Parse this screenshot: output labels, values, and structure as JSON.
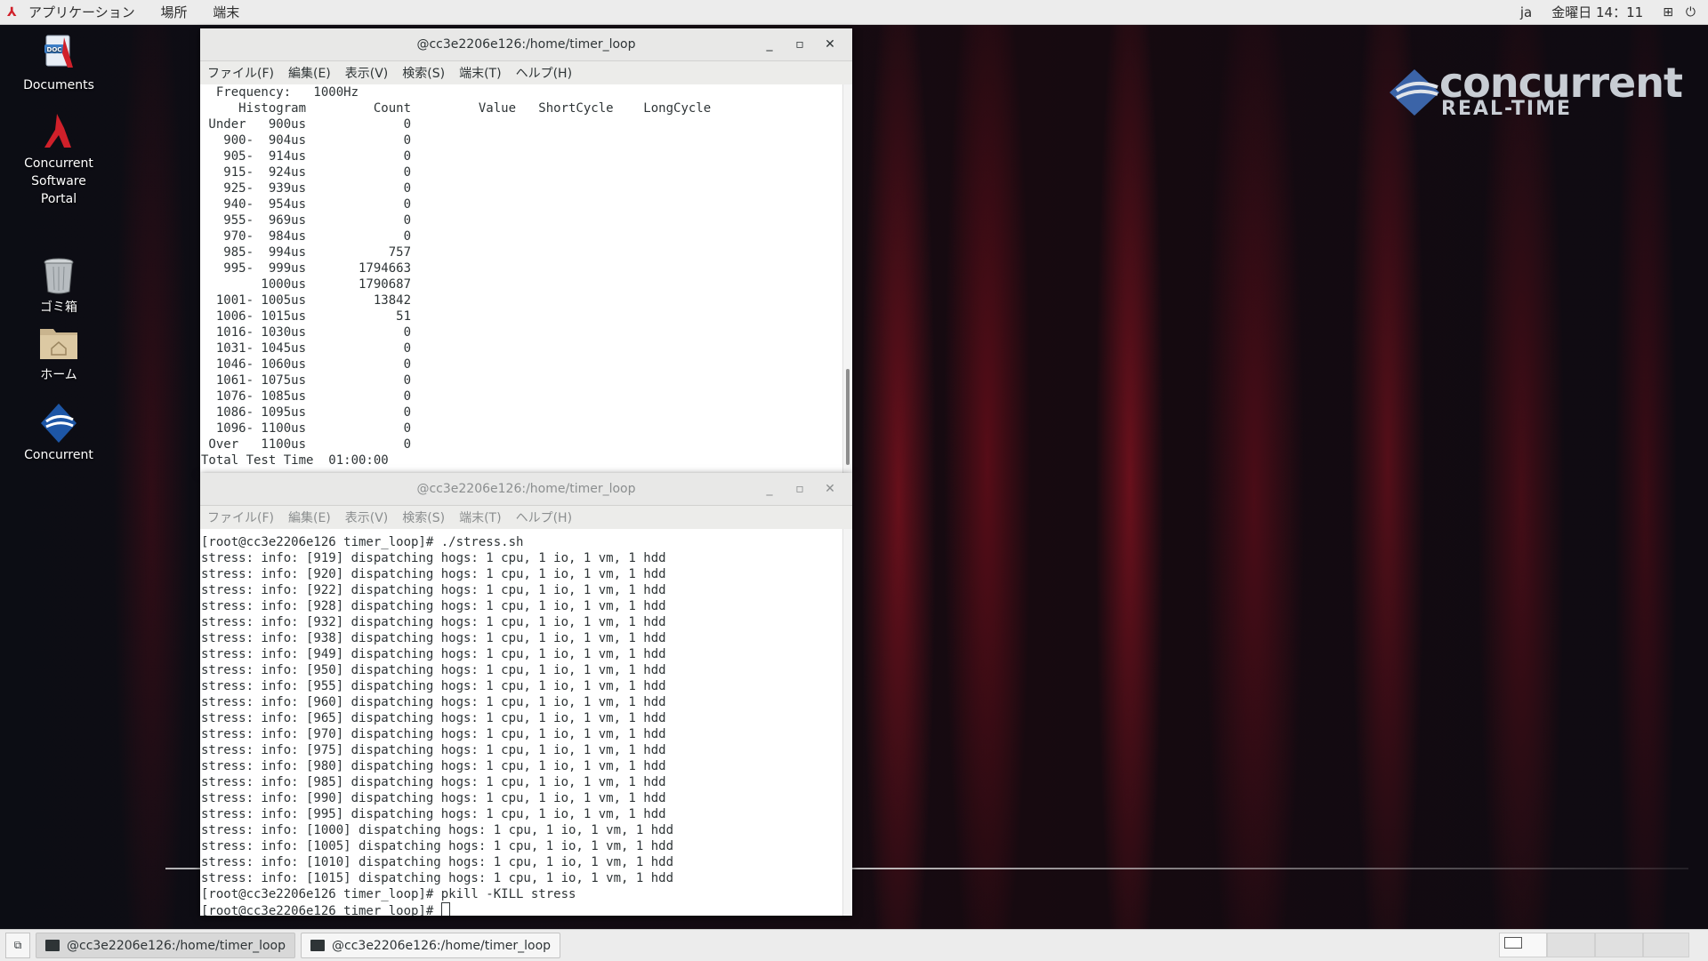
{
  "topbar": {
    "menus": [
      "アプリケーション",
      "場所",
      "端末"
    ],
    "lang": "ja",
    "clock": "金曜日 14：11"
  },
  "desktop": {
    "icons": [
      {
        "label": "Documents"
      },
      {
        "label": "Concurrent\nSoftware\nPortal"
      },
      {
        "label": "ゴミ箱"
      },
      {
        "label": "ホーム"
      },
      {
        "label": "Concurrent"
      }
    ],
    "logo": {
      "line1": "concurrent",
      "line2": "REAL-TIME"
    }
  },
  "window1": {
    "title": "@cc3e2206e126:/home/timer_loop",
    "menu": [
      "ファイル(F)",
      "編集(E)",
      "表示(V)",
      "検索(S)",
      "端末(T)",
      "ヘルプ(H)"
    ],
    "lines": [
      "  Frequency:   1000Hz",
      "     Histogram         Count         Value   ShortCycle    LongCycle",
      " Under   900us             0",
      "   900-  904us             0",
      "   905-  914us             0",
      "   915-  924us             0",
      "   925-  939us             0",
      "   940-  954us             0",
      "   955-  969us             0",
      "   970-  984us             0",
      "   985-  994us           757",
      "   995-  999us       1794663",
      "        1000us       1790687",
      "  1001- 1005us         13842",
      "  1006- 1015us            51",
      "  1016- 1030us             0",
      "  1031- 1045us             0",
      "  1046- 1060us             0",
      "  1061- 1075us             0",
      "  1076- 1085us             0",
      "  1086- 1095us             0",
      "  1096- 1100us             0",
      " Over   1100us             0",
      "Total Test Time  01:00:00"
    ]
  },
  "window2": {
    "title": "@cc3e2206e126:/home/timer_loop",
    "menu": [
      "ファイル(F)",
      "編集(E)",
      "表示(V)",
      "検索(S)",
      "端末(T)",
      "ヘルプ(H)"
    ],
    "lines": [
      "[root@cc3e2206e126 timer_loop]# ./stress.sh",
      "stress: info: [919] dispatching hogs: 1 cpu, 1 io, 1 vm, 1 hdd",
      "stress: info: [920] dispatching hogs: 1 cpu, 1 io, 1 vm, 1 hdd",
      "stress: info: [922] dispatching hogs: 1 cpu, 1 io, 1 vm, 1 hdd",
      "stress: info: [928] dispatching hogs: 1 cpu, 1 io, 1 vm, 1 hdd",
      "stress: info: [932] dispatching hogs: 1 cpu, 1 io, 1 vm, 1 hdd",
      "stress: info: [938] dispatching hogs: 1 cpu, 1 io, 1 vm, 1 hdd",
      "stress: info: [949] dispatching hogs: 1 cpu, 1 io, 1 vm, 1 hdd",
      "stress: info: [950] dispatching hogs: 1 cpu, 1 io, 1 vm, 1 hdd",
      "stress: info: [955] dispatching hogs: 1 cpu, 1 io, 1 vm, 1 hdd",
      "stress: info: [960] dispatching hogs: 1 cpu, 1 io, 1 vm, 1 hdd",
      "stress: info: [965] dispatching hogs: 1 cpu, 1 io, 1 vm, 1 hdd",
      "stress: info: [970] dispatching hogs: 1 cpu, 1 io, 1 vm, 1 hdd",
      "stress: info: [975] dispatching hogs: 1 cpu, 1 io, 1 vm, 1 hdd",
      "stress: info: [980] dispatching hogs: 1 cpu, 1 io, 1 vm, 1 hdd",
      "stress: info: [985] dispatching hogs: 1 cpu, 1 io, 1 vm, 1 hdd",
      "stress: info: [990] dispatching hogs: 1 cpu, 1 io, 1 vm, 1 hdd",
      "stress: info: [995] dispatching hogs: 1 cpu, 1 io, 1 vm, 1 hdd",
      "stress: info: [1000] dispatching hogs: 1 cpu, 1 io, 1 vm, 1 hdd",
      "stress: info: [1005] dispatching hogs: 1 cpu, 1 io, 1 vm, 1 hdd",
      "stress: info: [1010] dispatching hogs: 1 cpu, 1 io, 1 vm, 1 hdd",
      "stress: info: [1015] dispatching hogs: 1 cpu, 1 io, 1 vm, 1 hdd",
      "[root@cc3e2206e126 timer_loop]# pkill -KILL stress"
    ],
    "prompt": "[root@cc3e2206e126 timer_loop]# "
  },
  "taskbar": {
    "items": [
      "@cc3e2206e126:/home/timer_loop",
      "@cc3e2206e126:/home/timer_loop"
    ]
  }
}
